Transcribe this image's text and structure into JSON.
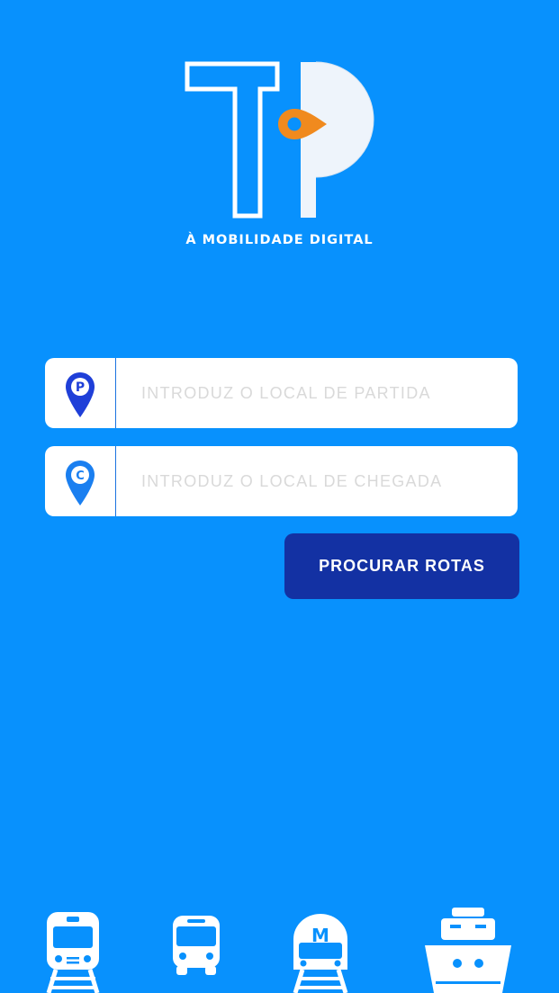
{
  "app": {
    "logo_letters": "TP",
    "tagline": "À MOBILIDADE DIGITAL"
  },
  "search": {
    "origin_placeholder": "INTRODUZ O LOCAL DE PARTIDA",
    "origin_value": "",
    "origin_pin_letter": "P",
    "destination_placeholder": "INTRODUZ O LOCAL DE CHEGADA",
    "destination_value": "",
    "destination_pin_letter": "C",
    "button_label": "PROCURAR ROTAS"
  },
  "transport_modes": [
    {
      "name": "train",
      "icon": "train-icon"
    },
    {
      "name": "bus",
      "icon": "bus-icon"
    },
    {
      "name": "metro",
      "icon": "metro-icon",
      "letter": "M"
    },
    {
      "name": "boat",
      "icon": "ship-icon"
    }
  ],
  "colors": {
    "background": "#0891fd",
    "button": "#1331a3",
    "pin_origin": "#1f3fd8",
    "pin_destination": "#1a7ff0",
    "logo_accent": "#f08a1e",
    "field_bg": "#ffffff"
  }
}
